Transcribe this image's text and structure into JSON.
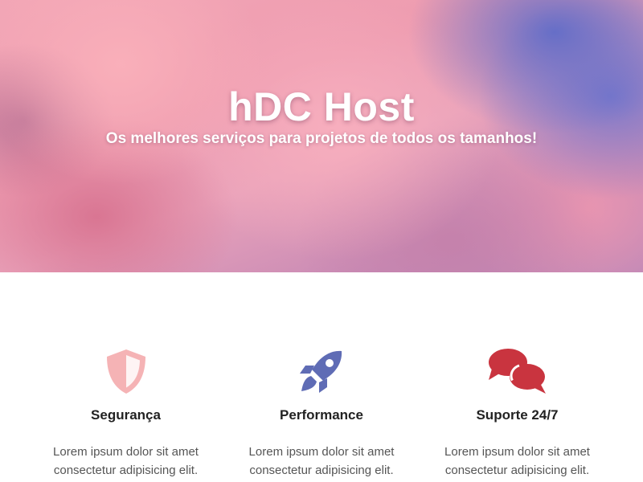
{
  "hero": {
    "title": "hDC Host",
    "subtitle": "Os melhores serviços para projetos de todos os tamanhos!"
  },
  "features": [
    {
      "icon": "shield-icon",
      "icon_color": "#f5b3b5",
      "title": "Segurança",
      "text": "Lorem ipsum dolor sit amet consectetur adipisicing elit."
    },
    {
      "icon": "rocket-icon",
      "icon_color": "#5f6cb5",
      "title": "Performance",
      "text": "Lorem ipsum dolor sit amet consectetur adipisicing elit."
    },
    {
      "icon": "chat-bubbles-icon",
      "icon_color": "#c9343f",
      "title": "Suporte 24/7",
      "text": "Lorem ipsum dolor sit amet consectetur adipisicing elit."
    }
  ]
}
